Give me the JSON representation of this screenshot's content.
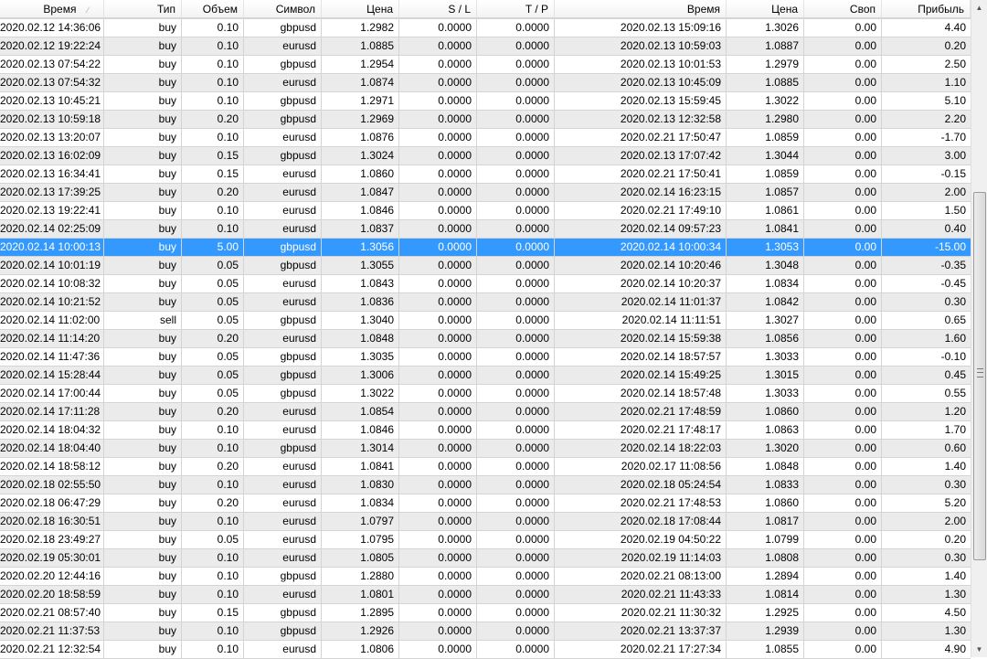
{
  "header": {
    "columns": [
      "Время",
      "Тип",
      "Объем",
      "Символ",
      "Цена",
      "S / L",
      "T / P",
      "Время",
      "Цена",
      "Своп",
      "Прибыль"
    ],
    "sort_indicator": "⁄"
  },
  "selected_row": 12,
  "colors": {
    "selection": "#3399ff",
    "alt_row": "#ebebeb"
  },
  "scrollbar": {
    "up_icon": "▲",
    "down_icon": "▼"
  },
  "rows": [
    [
      "2020.02.12 14:36:06",
      "buy",
      "0.10",
      "gbpusd",
      "1.2982",
      "0.0000",
      "0.0000",
      "2020.02.13 15:09:16",
      "1.3026",
      "0.00",
      "4.40"
    ],
    [
      "2020.02.12 19:22:24",
      "buy",
      "0.10",
      "eurusd",
      "1.0885",
      "0.0000",
      "0.0000",
      "2020.02.13 10:59:03",
      "1.0887",
      "0.00",
      "0.20"
    ],
    [
      "2020.02.13 07:54:22",
      "buy",
      "0.10",
      "gbpusd",
      "1.2954",
      "0.0000",
      "0.0000",
      "2020.02.13 10:01:53",
      "1.2979",
      "0.00",
      "2.50"
    ],
    [
      "2020.02.13 07:54:32",
      "buy",
      "0.10",
      "eurusd",
      "1.0874",
      "0.0000",
      "0.0000",
      "2020.02.13 10:45:09",
      "1.0885",
      "0.00",
      "1.10"
    ],
    [
      "2020.02.13 10:45:21",
      "buy",
      "0.10",
      "gbpusd",
      "1.2971",
      "0.0000",
      "0.0000",
      "2020.02.13 15:59:45",
      "1.3022",
      "0.00",
      "5.10"
    ],
    [
      "2020.02.13 10:59:18",
      "buy",
      "0.20",
      "gbpusd",
      "1.2969",
      "0.0000",
      "0.0000",
      "2020.02.13 12:32:58",
      "1.2980",
      "0.00",
      "2.20"
    ],
    [
      "2020.02.13 13:20:07",
      "buy",
      "0.10",
      "eurusd",
      "1.0876",
      "0.0000",
      "0.0000",
      "2020.02.21 17:50:47",
      "1.0859",
      "0.00",
      "-1.70"
    ],
    [
      "2020.02.13 16:02:09",
      "buy",
      "0.15",
      "gbpusd",
      "1.3024",
      "0.0000",
      "0.0000",
      "2020.02.13 17:07:42",
      "1.3044",
      "0.00",
      "3.00"
    ],
    [
      "2020.02.13 16:34:41",
      "buy",
      "0.15",
      "eurusd",
      "1.0860",
      "0.0000",
      "0.0000",
      "2020.02.21 17:50:41",
      "1.0859",
      "0.00",
      "-0.15"
    ],
    [
      "2020.02.13 17:39:25",
      "buy",
      "0.20",
      "eurusd",
      "1.0847",
      "0.0000",
      "0.0000",
      "2020.02.14 16:23:15",
      "1.0857",
      "0.00",
      "2.00"
    ],
    [
      "2020.02.13 19:22:41",
      "buy",
      "0.10",
      "eurusd",
      "1.0846",
      "0.0000",
      "0.0000",
      "2020.02.21 17:49:10",
      "1.0861",
      "0.00",
      "1.50"
    ],
    [
      "2020.02.14 02:25:09",
      "buy",
      "0.10",
      "eurusd",
      "1.0837",
      "0.0000",
      "0.0000",
      "2020.02.14 09:57:23",
      "1.0841",
      "0.00",
      "0.40"
    ],
    [
      "2020.02.14 10:00:13",
      "buy",
      "5.00",
      "gbpusd",
      "1.3056",
      "0.0000",
      "0.0000",
      "2020.02.14 10:00:34",
      "1.3053",
      "0.00",
      "-15.00"
    ],
    [
      "2020.02.14 10:01:19",
      "buy",
      "0.05",
      "gbpusd",
      "1.3055",
      "0.0000",
      "0.0000",
      "2020.02.14 10:20:46",
      "1.3048",
      "0.00",
      "-0.35"
    ],
    [
      "2020.02.14 10:08:32",
      "buy",
      "0.05",
      "eurusd",
      "1.0843",
      "0.0000",
      "0.0000",
      "2020.02.14 10:20:37",
      "1.0834",
      "0.00",
      "-0.45"
    ],
    [
      "2020.02.14 10:21:52",
      "buy",
      "0.05",
      "eurusd",
      "1.0836",
      "0.0000",
      "0.0000",
      "2020.02.14 11:01:37",
      "1.0842",
      "0.00",
      "0.30"
    ],
    [
      "2020.02.14 11:02:00",
      "sell",
      "0.05",
      "gbpusd",
      "1.3040",
      "0.0000",
      "0.0000",
      "2020.02.14 11:11:51",
      "1.3027",
      "0.00",
      "0.65"
    ],
    [
      "2020.02.14 11:14:20",
      "buy",
      "0.20",
      "eurusd",
      "1.0848",
      "0.0000",
      "0.0000",
      "2020.02.14 15:59:38",
      "1.0856",
      "0.00",
      "1.60"
    ],
    [
      "2020.02.14 11:47:36",
      "buy",
      "0.05",
      "gbpusd",
      "1.3035",
      "0.0000",
      "0.0000",
      "2020.02.14 18:57:57",
      "1.3033",
      "0.00",
      "-0.10"
    ],
    [
      "2020.02.14 15:28:44",
      "buy",
      "0.05",
      "gbpusd",
      "1.3006",
      "0.0000",
      "0.0000",
      "2020.02.14 15:49:25",
      "1.3015",
      "0.00",
      "0.45"
    ],
    [
      "2020.02.14 17:00:44",
      "buy",
      "0.05",
      "gbpusd",
      "1.3022",
      "0.0000",
      "0.0000",
      "2020.02.14 18:57:48",
      "1.3033",
      "0.00",
      "0.55"
    ],
    [
      "2020.02.14 17:11:28",
      "buy",
      "0.20",
      "eurusd",
      "1.0854",
      "0.0000",
      "0.0000",
      "2020.02.21 17:48:59",
      "1.0860",
      "0.00",
      "1.20"
    ],
    [
      "2020.02.14 18:04:32",
      "buy",
      "0.10",
      "eurusd",
      "1.0846",
      "0.0000",
      "0.0000",
      "2020.02.21 17:48:17",
      "1.0863",
      "0.00",
      "1.70"
    ],
    [
      "2020.02.14 18:04:40",
      "buy",
      "0.10",
      "gbpusd",
      "1.3014",
      "0.0000",
      "0.0000",
      "2020.02.14 18:22:03",
      "1.3020",
      "0.00",
      "0.60"
    ],
    [
      "2020.02.14 18:58:12",
      "buy",
      "0.20",
      "eurusd",
      "1.0841",
      "0.0000",
      "0.0000",
      "2020.02.17 11:08:56",
      "1.0848",
      "0.00",
      "1.40"
    ],
    [
      "2020.02.18 02:55:50",
      "buy",
      "0.10",
      "eurusd",
      "1.0830",
      "0.0000",
      "0.0000",
      "2020.02.18 05:24:54",
      "1.0833",
      "0.00",
      "0.30"
    ],
    [
      "2020.02.18 06:47:29",
      "buy",
      "0.20",
      "eurusd",
      "1.0834",
      "0.0000",
      "0.0000",
      "2020.02.21 17:48:53",
      "1.0860",
      "0.00",
      "5.20"
    ],
    [
      "2020.02.18 16:30:51",
      "buy",
      "0.10",
      "eurusd",
      "1.0797",
      "0.0000",
      "0.0000",
      "2020.02.18 17:08:44",
      "1.0817",
      "0.00",
      "2.00"
    ],
    [
      "2020.02.18 23:49:27",
      "buy",
      "0.05",
      "eurusd",
      "1.0795",
      "0.0000",
      "0.0000",
      "2020.02.19 04:50:22",
      "1.0799",
      "0.00",
      "0.20"
    ],
    [
      "2020.02.19 05:30:01",
      "buy",
      "0.10",
      "eurusd",
      "1.0805",
      "0.0000",
      "0.0000",
      "2020.02.19 11:14:03",
      "1.0808",
      "0.00",
      "0.30"
    ],
    [
      "2020.02.20 12:44:16",
      "buy",
      "0.10",
      "gbpusd",
      "1.2880",
      "0.0000",
      "0.0000",
      "2020.02.21 08:13:00",
      "1.2894",
      "0.00",
      "1.40"
    ],
    [
      "2020.02.20 18:58:59",
      "buy",
      "0.10",
      "eurusd",
      "1.0801",
      "0.0000",
      "0.0000",
      "2020.02.21 11:43:33",
      "1.0814",
      "0.00",
      "1.30"
    ],
    [
      "2020.02.21 08:57:40",
      "buy",
      "0.15",
      "gbpusd",
      "1.2895",
      "0.0000",
      "0.0000",
      "2020.02.21 11:30:32",
      "1.2925",
      "0.00",
      "4.50"
    ],
    [
      "2020.02.21 11:37:53",
      "buy",
      "0.10",
      "gbpusd",
      "1.2926",
      "0.0000",
      "0.0000",
      "2020.02.21 13:37:37",
      "1.2939",
      "0.00",
      "1.30"
    ],
    [
      "2020.02.21 12:32:54",
      "buy",
      "0.10",
      "eurusd",
      "1.0806",
      "0.0000",
      "0.0000",
      "2020.02.21 17:27:34",
      "1.0855",
      "0.00",
      "4.90"
    ]
  ]
}
